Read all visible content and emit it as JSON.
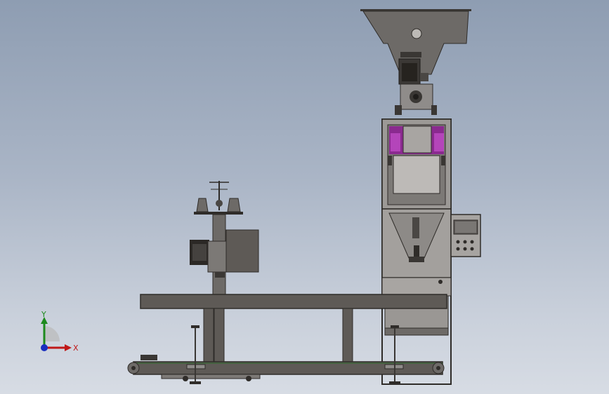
{
  "viewport": {
    "background_top": "#8e9db2",
    "background_bottom": "#d7dce4"
  },
  "triad": {
    "y_label": "Y",
    "x_label": "X",
    "y_color": "#1d8a1d",
    "x_color": "#c01818",
    "z_color": "#1a2fbf"
  },
  "model": {
    "frame_color": "#5e5a56",
    "frame_dark": "#2f2c29",
    "hopper_color": "#6d6a67",
    "accent_purple": "#8a2a8f",
    "panel_color": "#8f8c8a"
  }
}
